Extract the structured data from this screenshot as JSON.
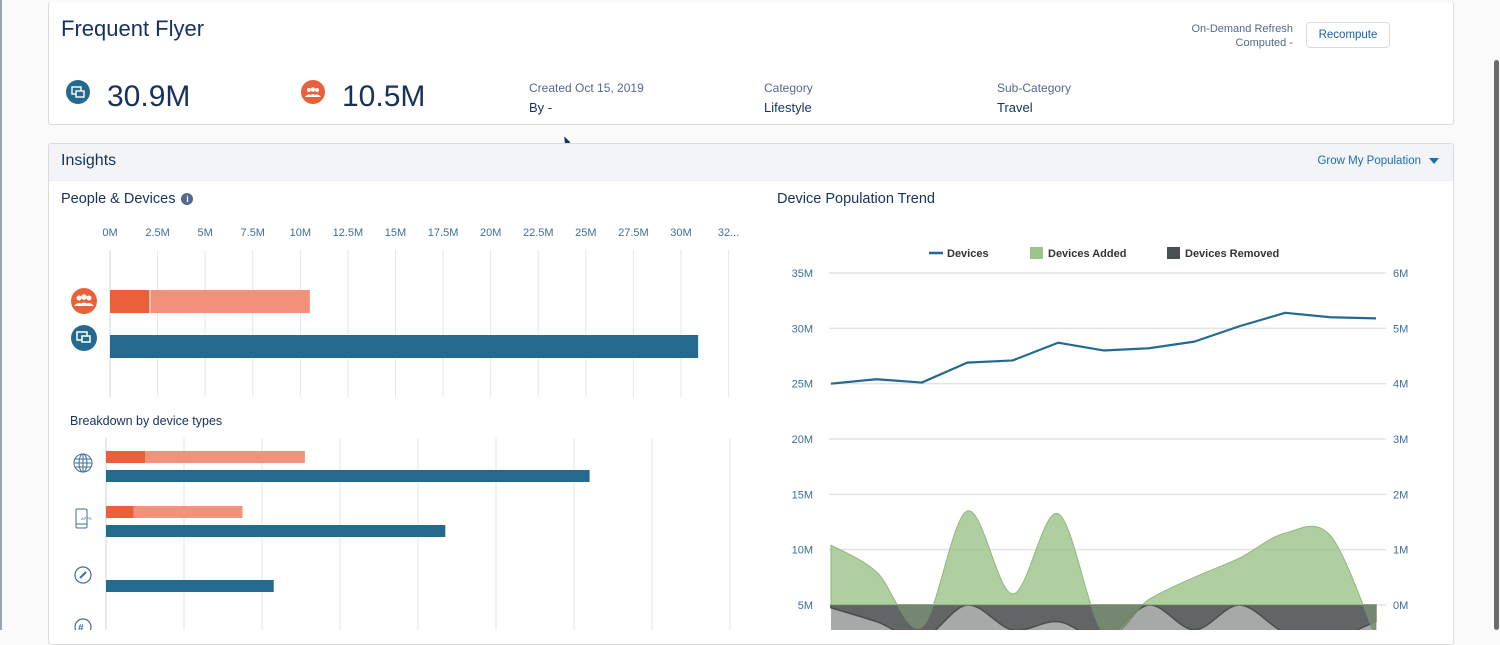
{
  "header": {
    "title": "Frequent Flyer",
    "devices_count": "30.9M",
    "people_count": "10.5M",
    "created_label": "Created Oct 15, 2019",
    "created_by": "By -",
    "category_label": "Category",
    "category_value": "Lifestyle",
    "subcategory_label": "Sub-Category",
    "subcategory_value": "Travel",
    "refresh_line1": "On-Demand Refresh",
    "refresh_line2": "Computed -",
    "recompute_label": "Recompute"
  },
  "insights": {
    "title": "Insights",
    "grow_label": "Grow My Population",
    "people_devices_title": "People & Devices",
    "breakdown_title": "Breakdown by device types",
    "trend_title": "Device Population Trend"
  },
  "colors": {
    "people_dark": "#e9603a",
    "people_light": "#f4917a",
    "devices": "#236a8e",
    "added": "#9cc38a",
    "removed": "#4a4f4f",
    "axis_text": "#3d6e99"
  },
  "chart_data": [
    {
      "type": "bar",
      "title": "People & Devices",
      "orientation": "horizontal",
      "xticks": [
        "0M",
        "2.5M",
        "5M",
        "7.5M",
        "10M",
        "12.5M",
        "15M",
        "17.5M",
        "20M",
        "22.5M",
        "25M",
        "27.5M",
        "30M",
        "32..."
      ],
      "xlim": [
        0,
        32.5
      ],
      "unit": "M",
      "rows": [
        {
          "name": "people",
          "icon": "people-icon",
          "segments": [
            {
              "name": "people-primary",
              "value": 2.1
            },
            {
              "name": "people-total",
              "value": 10.5
            }
          ]
        },
        {
          "name": "devices",
          "icon": "devices-icon",
          "segments": [
            {
              "name": "devices-total",
              "value": 30.9
            }
          ]
        }
      ]
    },
    {
      "type": "bar",
      "title": "Breakdown by device types",
      "orientation": "horizontal",
      "xlim": [
        0,
        15.5
      ],
      "unit": "M",
      "rows": [
        {
          "name": "web",
          "icon": "globe-icon",
          "people_primary": 1.0,
          "people_total": 5.1,
          "devices": 12.4
        },
        {
          "name": "apps",
          "icon": "mobile-apps-icon",
          "people_primary": 0.7,
          "people_total": 3.5,
          "devices": 8.7
        },
        {
          "name": "safari",
          "icon": "compass-icon",
          "people_primary": 0,
          "people_total": 0,
          "devices": 4.3
        },
        {
          "name": "other",
          "icon": "hashtag-icon",
          "people_primary": 0,
          "people_total": 0,
          "devices": 0
        }
      ]
    },
    {
      "type": "line",
      "title": "Device Population Trend",
      "legend": [
        "Devices",
        "Devices Added",
        "Devices Removed"
      ],
      "legend_position": "top-center",
      "left_axis": {
        "ticks": [
          "35M",
          "30M",
          "25M",
          "20M",
          "15M",
          "10M",
          "5M"
        ],
        "ylim": [
          0,
          35
        ]
      },
      "right_axis": {
        "ticks": [
          "6M",
          "5M",
          "4M",
          "3M",
          "2M",
          "1M",
          "0M"
        ],
        "ylim": [
          -1,
          6
        ]
      },
      "series": [
        {
          "name": "Devices",
          "axis": "left",
          "type": "line",
          "values": [
            25.0,
            25.4,
            25.1,
            26.9,
            27.1,
            28.7,
            28.0,
            28.2,
            28.8,
            30.2,
            31.4,
            31.0,
            30.9
          ]
        },
        {
          "name": "Devices Added",
          "axis": "right",
          "type": "area",
          "values": [
            1.08,
            0.6,
            -0.4,
            1.7,
            0.2,
            1.65,
            -0.5,
            0.1,
            0.5,
            0.85,
            1.3,
            1.25,
            -0.6
          ]
        },
        {
          "name": "Devices Removed",
          "axis": "right",
          "type": "area",
          "values": [
            -0.05,
            -0.3,
            -0.6,
            0.0,
            -0.45,
            -0.3,
            -0.6,
            0.0,
            -0.45,
            0.0,
            -0.5,
            -0.6,
            -0.3
          ]
        }
      ]
    }
  ]
}
